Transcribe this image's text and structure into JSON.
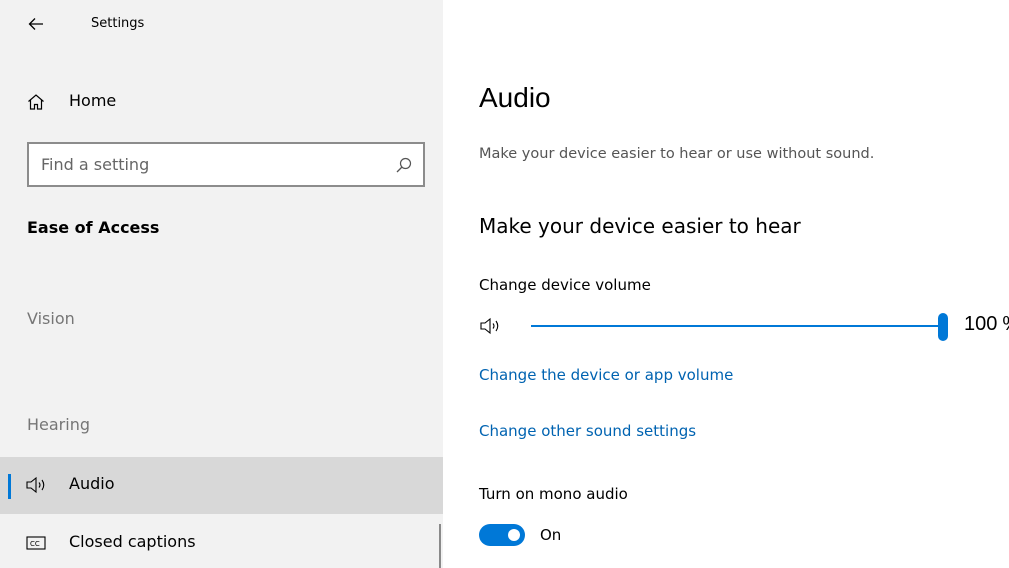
{
  "window": {
    "title": "Settings"
  },
  "sidebar": {
    "home_label": "Home",
    "search_placeholder": "Find a setting",
    "section_title": "Ease of Access",
    "groups": [
      {
        "label": "Vision"
      },
      {
        "label": "Hearing"
      }
    ],
    "items": [
      {
        "label": "Audio",
        "icon": "speaker-icon",
        "selected": true
      },
      {
        "label": "Closed captions",
        "icon": "closed-captions-icon",
        "selected": false
      }
    ]
  },
  "main": {
    "title": "Audio",
    "description": "Make your device easier to hear or use without sound.",
    "subheading": "Make your device easier to hear",
    "volume": {
      "label": "Change device volume",
      "value": 100,
      "unit": "%"
    },
    "links": [
      {
        "label": "Change the device or app volume"
      },
      {
        "label": "Change other sound settings"
      }
    ],
    "mono": {
      "label": "Turn on mono audio",
      "state": "On",
      "enabled": true
    }
  },
  "colors": {
    "accent": "#0078d7",
    "link": "#0063b1",
    "sidebar_bg": "#f2f2f2",
    "selected_bg": "#d8d8d8",
    "muted_text": "#767676"
  }
}
